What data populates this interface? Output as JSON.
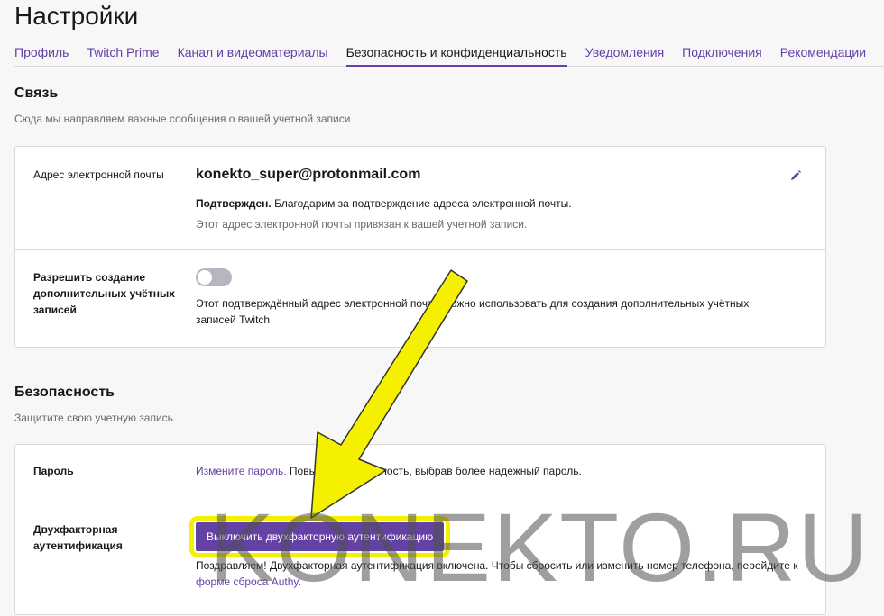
{
  "title": "Настройки",
  "tabs": [
    {
      "label": "Профиль"
    },
    {
      "label": "Twitch Prime"
    },
    {
      "label": "Канал и видеоматериалы"
    },
    {
      "label": "Безопасность и конфиденциальность",
      "active": true
    },
    {
      "label": "Уведомления"
    },
    {
      "label": "Подключения"
    },
    {
      "label": "Рекомендации"
    }
  ],
  "contact": {
    "heading": "Связь",
    "subtitle": "Сюда мы направляем важные сообщения о вашей учетной записи",
    "email_label": "Адрес электронной почты",
    "email": "konekto_super@protonmail.com",
    "verified_bold": "Подтвержден.",
    "verified_text": " Благодарим за подтверждение адреса электронной почты.",
    "linked_text": "Этот адрес электронной почты привязан к вашей учетной записи.",
    "multi_label": "Разрешить создание дополнительных учётных записей",
    "multi_enabled": false,
    "multi_text": "Этот подтверждённый адрес электронной почты можно использовать для создания дополнительных учётных записей Twitch"
  },
  "security": {
    "heading": "Безопасность",
    "subtitle": "Защитите свою учетную запись",
    "password_label": "Пароль",
    "password_link": "Измените пароль.",
    "password_text": " Повысьте безопасность, выбрав более надежный пароль.",
    "twofa_label": "Двухфакторная аутентификация",
    "twofa_button": "Выключить двухфакторную аутентификацию",
    "twofa_text": "Поздравляем! Двухфакторная аутентификация включена. Чтобы сбросить или изменить номер телефона, перейдите к ",
    "twofa_link": "форме сброса Authy",
    "twofa_end": "."
  },
  "watermark": "KONEKTO.RU",
  "colors": {
    "accent": "#6441a4",
    "highlight": "#f4f000"
  }
}
